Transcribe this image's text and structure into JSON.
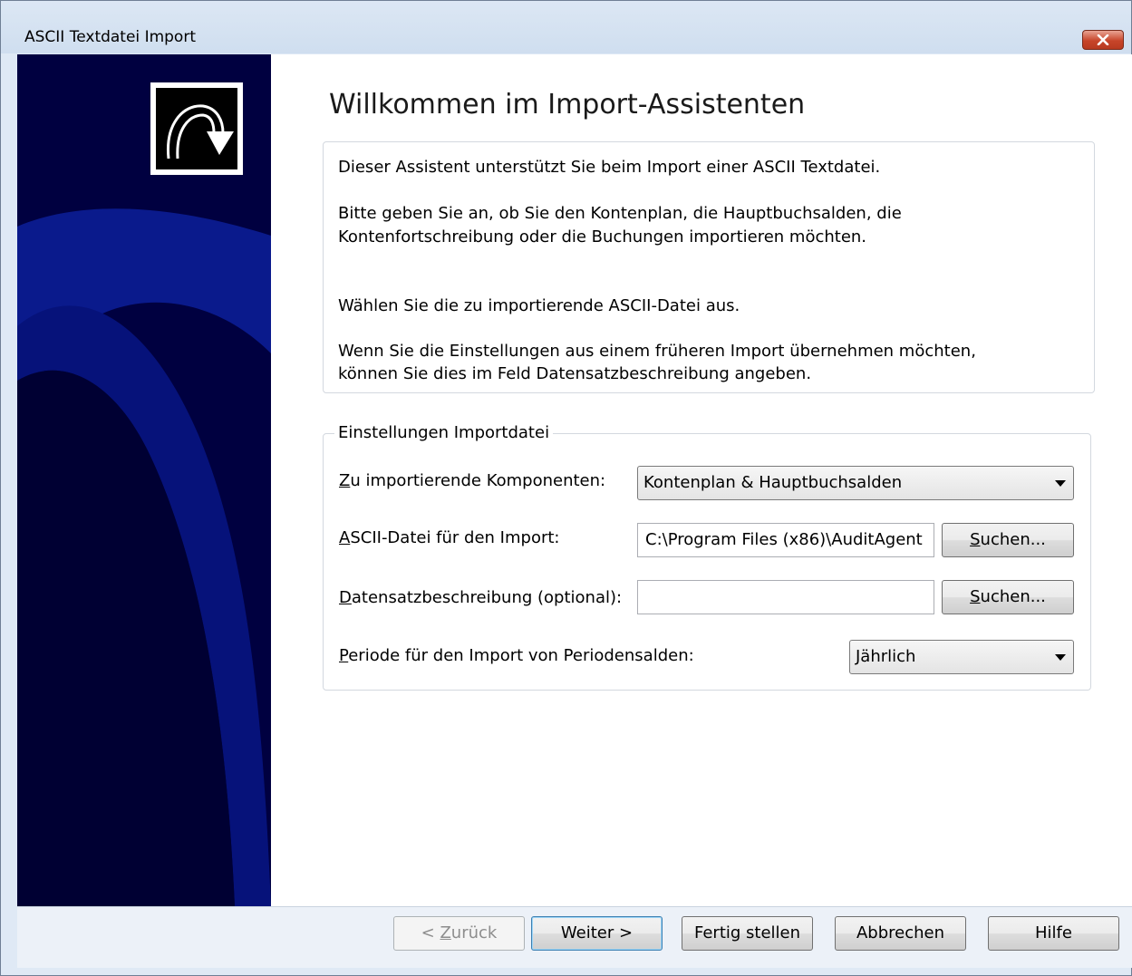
{
  "window": {
    "title": "ASCII Textdatei Import"
  },
  "page": {
    "heading": "Willkommen im Import-Assistenten"
  },
  "info": {
    "line1": "Dieser Assistent unterstützt Sie beim Import einer ASCII Textdatei.",
    "line2a": "Bitte geben Sie an, ob Sie den Kontenplan, die Hauptbuchsalden, die",
    "line2b": "Kontenfortschreibung oder die Buchungen importieren möchten.",
    "line3": "Wählen Sie die zu importierende ASCII-Datei aus.",
    "line4a": "Wenn Sie die Einstellungen aus einem früheren Import übernehmen möchten,",
    "line4b": "können Sie dies im Feld Datensatzbeschreibung angeben."
  },
  "settings": {
    "legend": "Einstellungen Importdatei",
    "components_label_first": "Z",
    "components_label_rest": "u importierende Komponenten:",
    "components_value": "Kontenplan & Hauptbuchsalden",
    "ascii_label_first": "A",
    "ascii_label_rest": "SCII-Datei für den Import:",
    "ascii_value": "C:\\Program Files (x86)\\AuditAgent",
    "search_first": "S",
    "search_rest": "uchen...",
    "record_label_first": "D",
    "record_label_rest": "atensatzbeschreibung (optional):",
    "record_value": "",
    "period_label_first": "P",
    "period_label_rest": "eriode für den Import von Periodensalden:",
    "period_value": "Jährlich"
  },
  "footer": {
    "back_prefix": "< ",
    "back_first": "Z",
    "back_rest": "urück",
    "next": "Weiter >",
    "finish": "Fertig stellen",
    "cancel": "Abbrechen",
    "help": "Hilfe"
  },
  "colors": {
    "sidebar": "#000040",
    "sidebar_arc": "#0a1a8c",
    "close_button": "#c7452a"
  },
  "icons": {
    "logo": "forward-arrow-icon",
    "close": "close-icon",
    "dropdown": "chevron-down-icon"
  }
}
